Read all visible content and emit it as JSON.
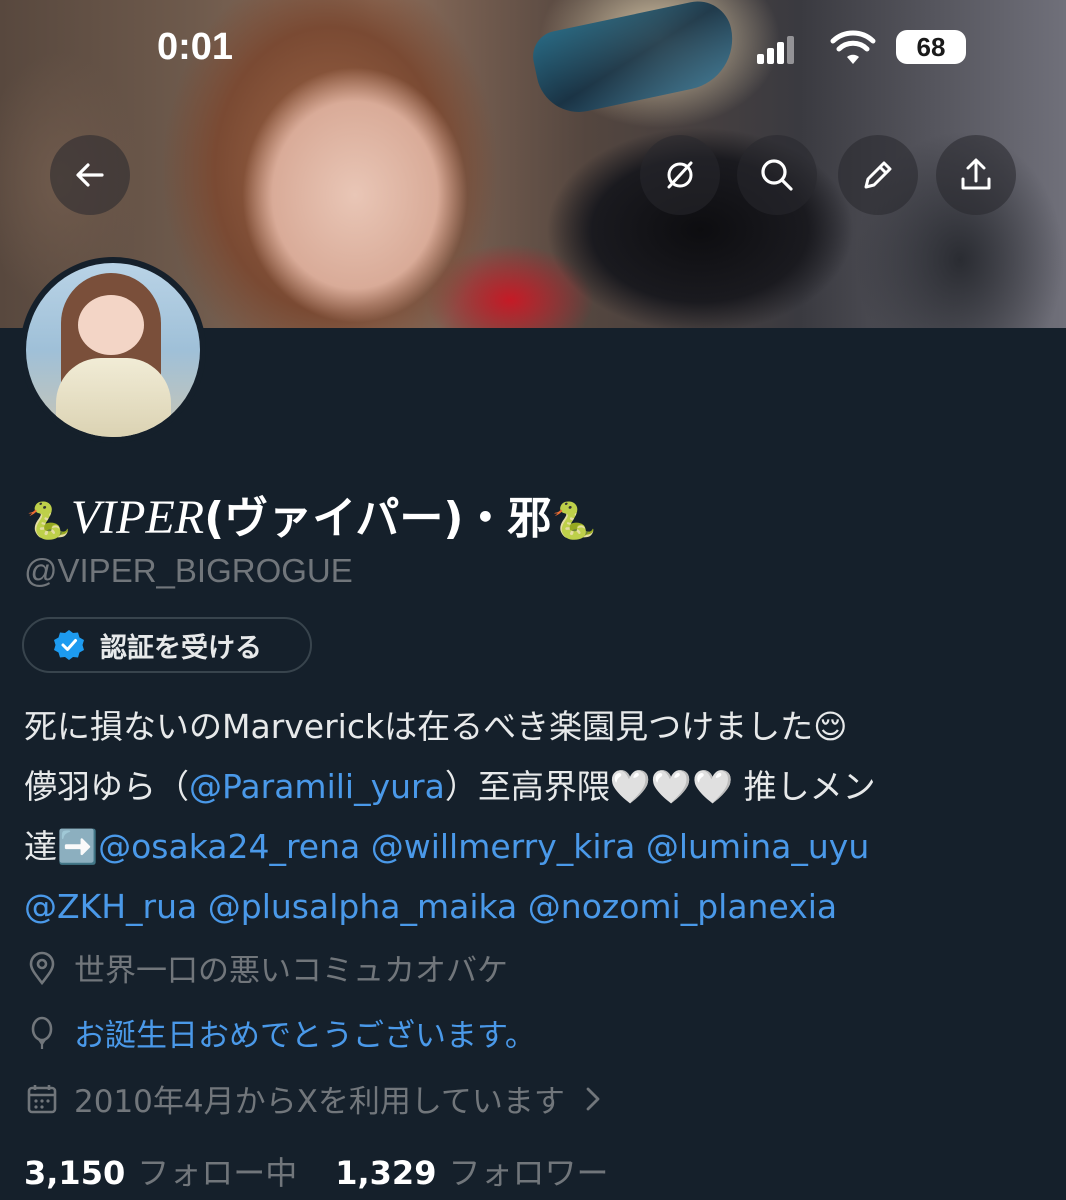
{
  "status_bar": {
    "time": "0:01",
    "battery": "68"
  },
  "header": {
    "back": "back-arrow-icon",
    "actions": [
      "grok-icon",
      "search-icon",
      "edit-icon",
      "share-icon"
    ]
  },
  "profile": {
    "name_snake_left": "🐍",
    "name_italic": "VIPER",
    "name_rest": "(ヴァイパー)・邪",
    "name_snake_right": "🐍",
    "handle": "@VIPER_BIGROGUE",
    "verify_label": "認証を受ける",
    "bio": {
      "line1_text": "死に損ないのMarverickは在るべき楽園見つけました",
      "line1_emoji": "😌",
      "line2_pre": "儚羽ゆら（",
      "line2_mention": "@Paramili_yura",
      "line2_post": "）至高界隈",
      "line2_hearts": "🤍🤍🤍",
      "line2_tail": " 推しメン",
      "line3_pre": "達",
      "line3_emoji": "➡️",
      "line3_mentions": [
        "@osaka24_rena",
        "@willmerry_kira",
        "@lumina_uyu"
      ],
      "line4_mentions": [
        "@ZKH_rua",
        "@plusalpha_maika",
        "@nozomi_planexia"
      ]
    },
    "location": "世界一口の悪いコミュカオバケ",
    "birthday": "お誕生日おめでとうございます。",
    "joined": "2010年4月からXを利用しています",
    "following_count": "3,150",
    "following_label": "フォロー中",
    "followers_count": "1,329",
    "followers_label": "フォロワー"
  },
  "colors": {
    "background": "#15202b",
    "link": "#4a99e9",
    "muted": "#71767b",
    "verified": "#1d9bf0"
  }
}
